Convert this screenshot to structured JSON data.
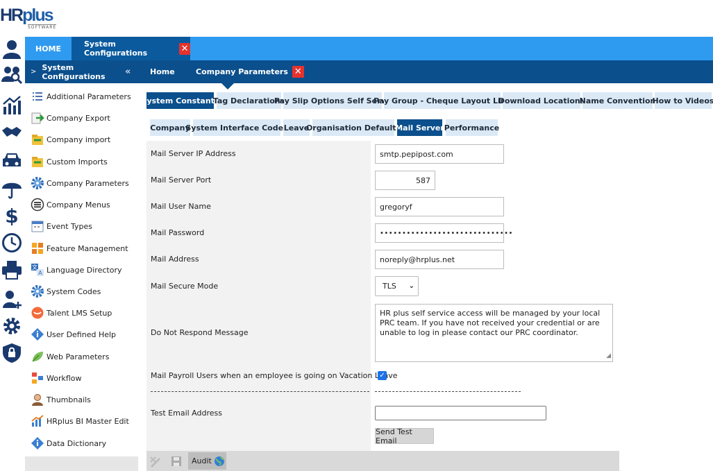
{
  "brand": {
    "logo_hr": "HR",
    "logo_plus": "plus",
    "logo_software": "SOFTWARE"
  },
  "top_tabs": {
    "home": "HOME",
    "system_configurations": "System Configurations",
    "close": "✕"
  },
  "sub_tabs": {
    "section_title": "System Configurations",
    "home": "Home",
    "company_parameters": "Company Parameters",
    "close": "✕",
    "collapse": "«"
  },
  "sidebar": {
    "items": [
      {
        "label": "Additional Parameters",
        "icon": "list-icon"
      },
      {
        "label": "Company Export",
        "icon": "export-icon"
      },
      {
        "label": "Company import",
        "icon": "import-icon"
      },
      {
        "label": "Custom Imports",
        "icon": "custom-import-icon"
      },
      {
        "label": "Company Parameters",
        "icon": "gear-icon"
      },
      {
        "label": "Company Menus",
        "icon": "menu-icon"
      },
      {
        "label": "Event Types",
        "icon": "calendar-icon"
      },
      {
        "label": "Feature Management",
        "icon": "feature-icon"
      },
      {
        "label": "Language Directory",
        "icon": "language-icon"
      },
      {
        "label": "System Codes",
        "icon": "gear-icon"
      },
      {
        "label": "Talent LMS Setup",
        "icon": "talent-icon"
      },
      {
        "label": "User Defined Help",
        "icon": "info-icon"
      },
      {
        "label": "Web Parameters",
        "icon": "leaf-icon"
      },
      {
        "label": "Workflow",
        "icon": "workflow-icon"
      },
      {
        "label": "Thumbnails",
        "icon": "person-icon"
      },
      {
        "label": "HRplus BI Master Edit",
        "icon": "bar-chart-icon"
      },
      {
        "label": "Data Dictionary",
        "icon": "info-icon"
      }
    ]
  },
  "category_tabs": [
    "System Constants",
    "Tag Declarations",
    "Pay Slip Options Self Serve",
    "Pay Group - Cheque Layout Link",
    "Download Locations",
    "Name Convention",
    "How to Videos"
  ],
  "section_tabs": [
    "Company",
    "System Interface Codes",
    "Leave",
    "Organisation Defaults",
    "Mail Server",
    "Performance"
  ],
  "form": {
    "ip_label": "Mail Server IP Address",
    "ip_value": "smtp.pepipost.com",
    "port_label": "Mail Server Port",
    "port_value": "587",
    "user_label": "Mail User Name",
    "user_value": "gregoryf",
    "password_label": "Mail Password",
    "password_value": "••••••••••••••••••••••••••••••",
    "address_label": "Mail Address",
    "address_value": "noreply@hrplus.net",
    "secure_label": "Mail Secure Mode",
    "secure_value": "TLS",
    "message_label": "Do Not Respond Message",
    "message_value": "HR plus self service access will be managed by your local PRC team. If you have not received your credential or are unable to log in please contact our PRC coordinator.",
    "payroll_label": "Mail Payroll Users when an employee is going on Vacation Leave",
    "payroll_checked": "✓",
    "test_label": "Test Email Address",
    "test_value": "",
    "send_button": "Send Test Email"
  },
  "toolbar": {
    "audit_label": "Audit"
  },
  "colors": {
    "top_bar": "#2f9bf0",
    "dark_bar": "#0b4f8c",
    "tab_bg": "#dbe9f6",
    "close_red": "#e5322d"
  }
}
